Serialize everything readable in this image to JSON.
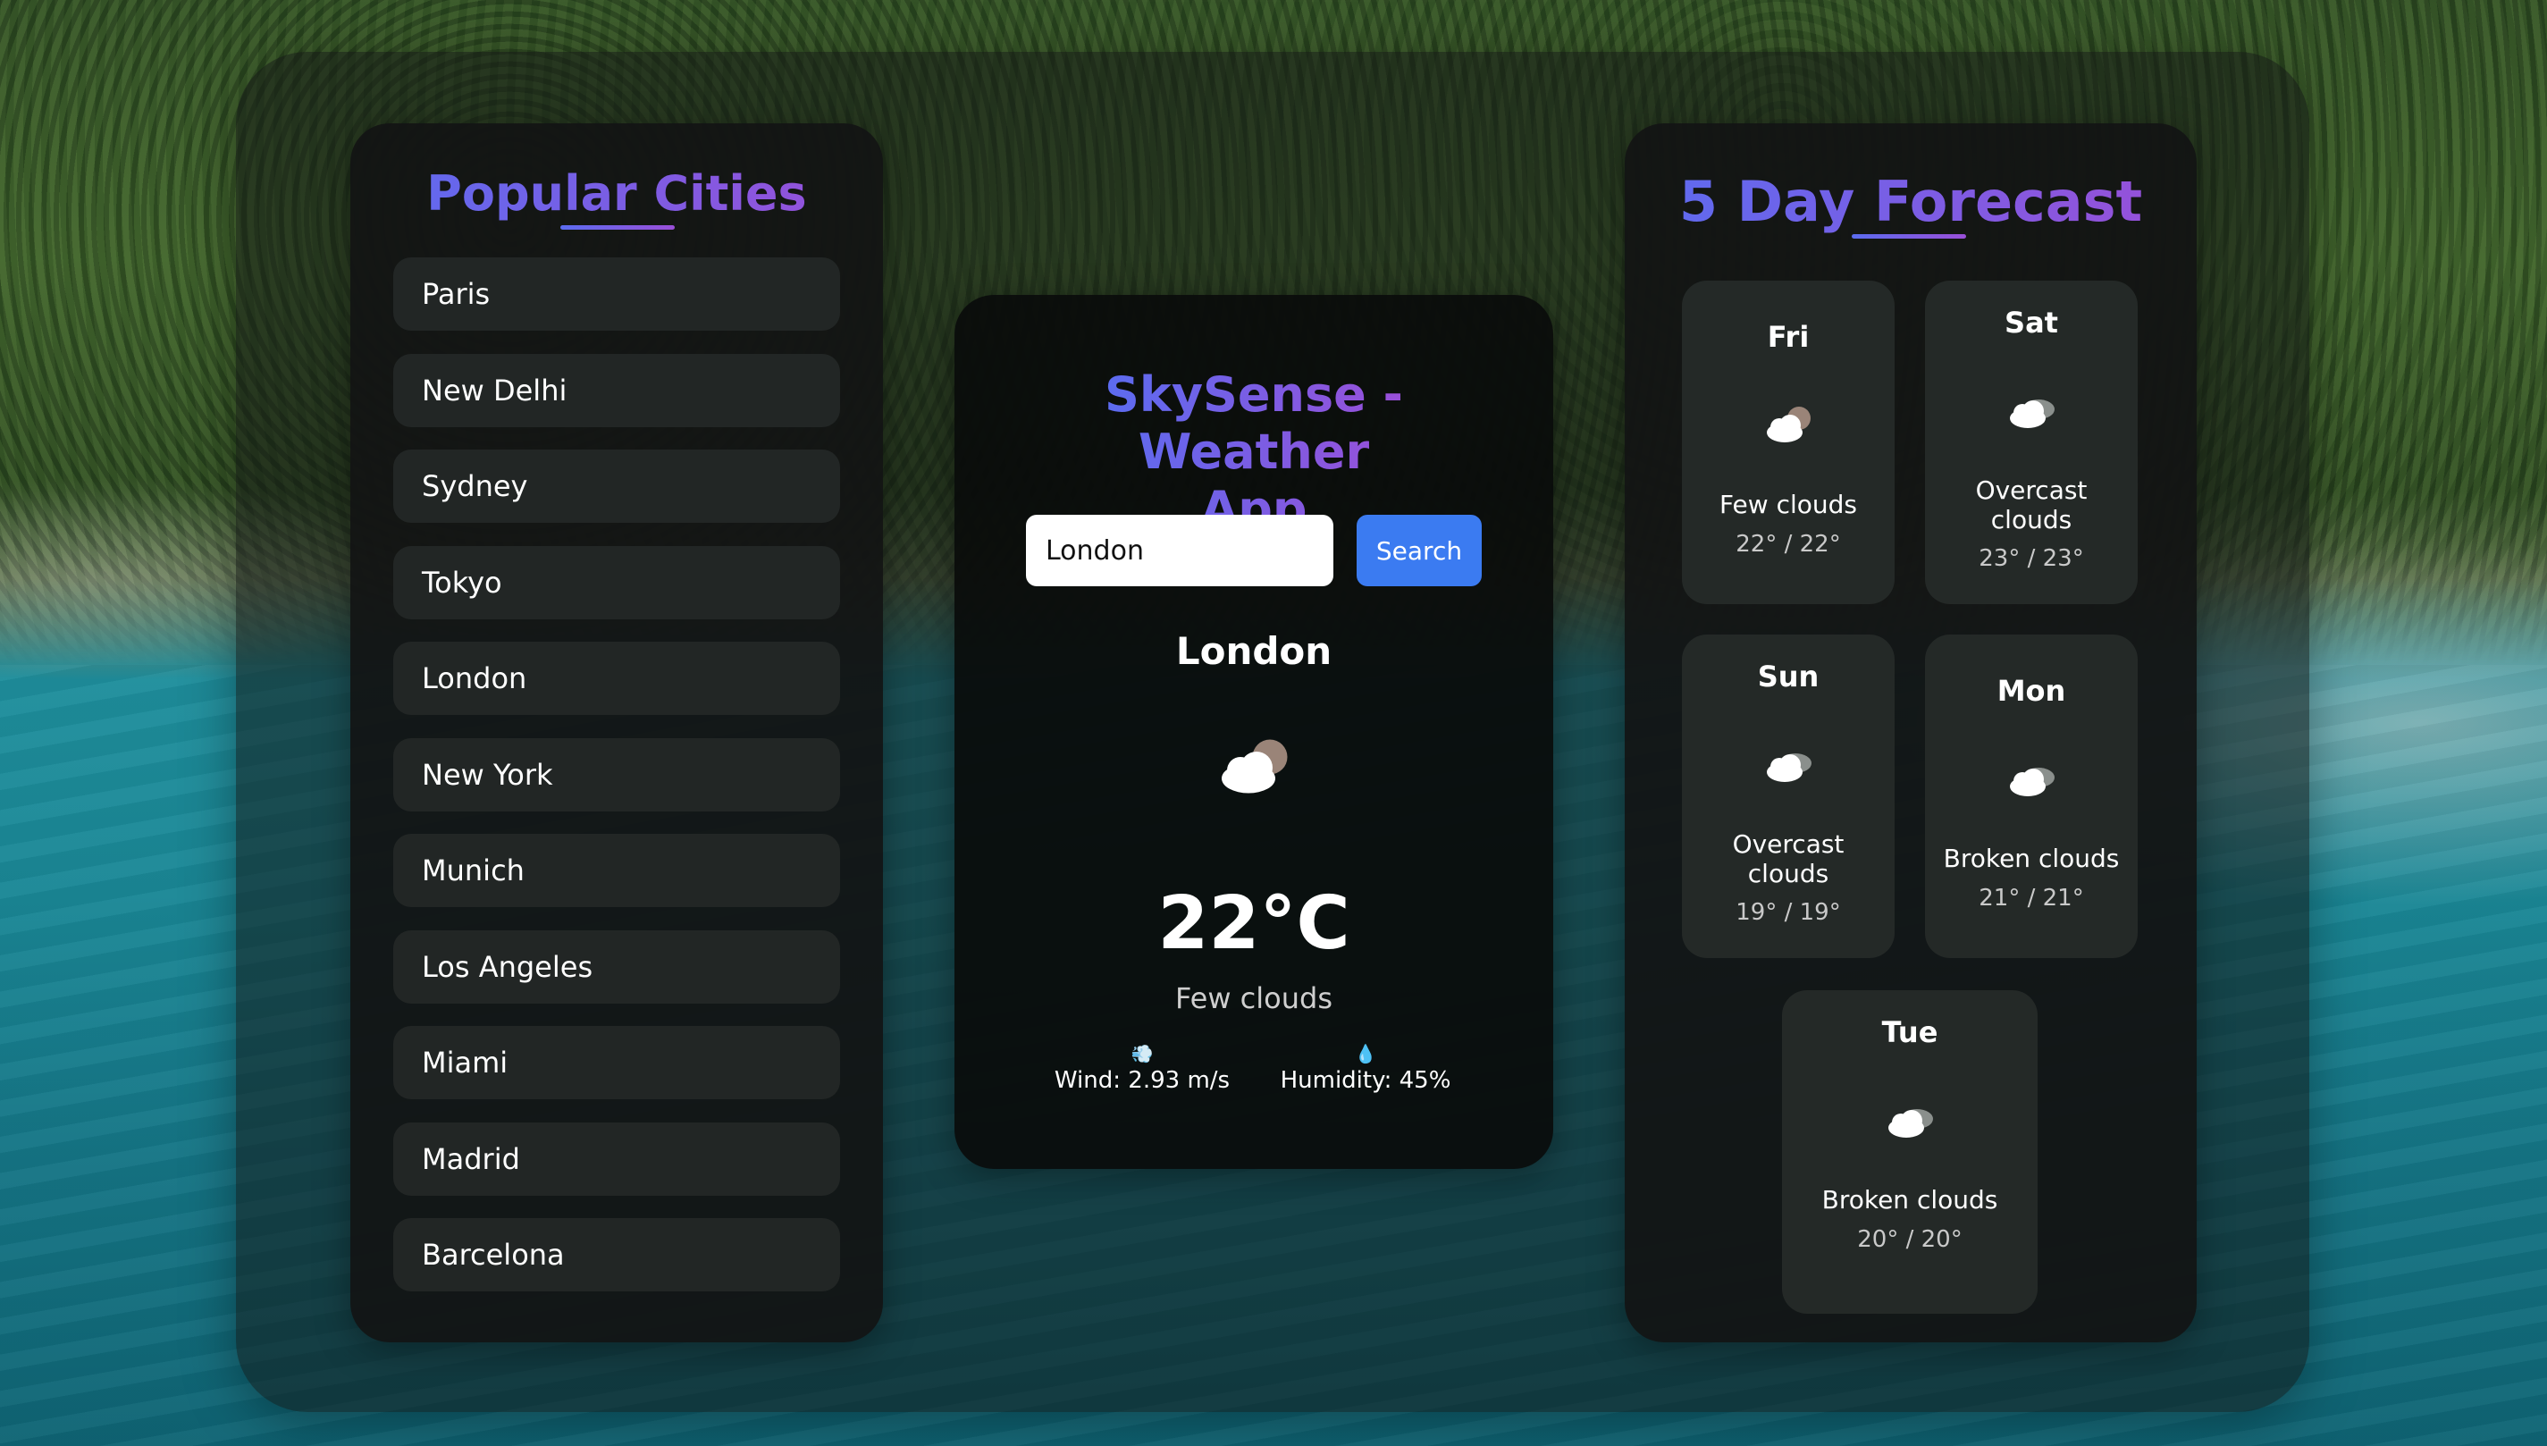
{
  "cities_panel": {
    "title": "Popular Cities",
    "items": [
      "Paris",
      "New Delhi",
      "Sydney",
      "Tokyo",
      "London",
      "New York",
      "Munich",
      "Los Angeles",
      "Miami",
      "Madrid",
      "Barcelona"
    ]
  },
  "main": {
    "title": "SkySense - Weather App",
    "search": {
      "value": "London",
      "placeholder": "",
      "button_label": "Search"
    },
    "city": "London",
    "icon": "few-clouds-icon",
    "temperature": "22°C",
    "description": "Few clouds",
    "wind_icon": "wind-icon",
    "wind": "Wind: 2.93 m/s",
    "humidity_icon": "droplet-icon",
    "humidity": "Humidity: 45%"
  },
  "forecast": {
    "title": "5 Day Forecast",
    "days": [
      {
        "day": "Fri",
        "icon": "few-clouds-icon",
        "desc": "Few clouds",
        "temp": "22° / 22°"
      },
      {
        "day": "Sat",
        "icon": "overcast-clouds-icon",
        "desc": "Overcast clouds",
        "temp": "23° / 23°"
      },
      {
        "day": "Sun",
        "icon": "overcast-clouds-icon",
        "desc": "Overcast clouds",
        "temp": "19° / 19°"
      },
      {
        "day": "Mon",
        "icon": "broken-clouds-icon",
        "desc": "Broken clouds",
        "temp": "21° / 21°"
      },
      {
        "day": "Tue",
        "icon": "broken-clouds-icon",
        "desc": "Broken clouds",
        "temp": "20° / 20°"
      }
    ]
  },
  "colors": {
    "accent_gradient_start": "#5b6cf0",
    "accent_gradient_end": "#9a4fd8",
    "button": "#3b7bf1",
    "panel": "#121413",
    "card": "#242927"
  }
}
